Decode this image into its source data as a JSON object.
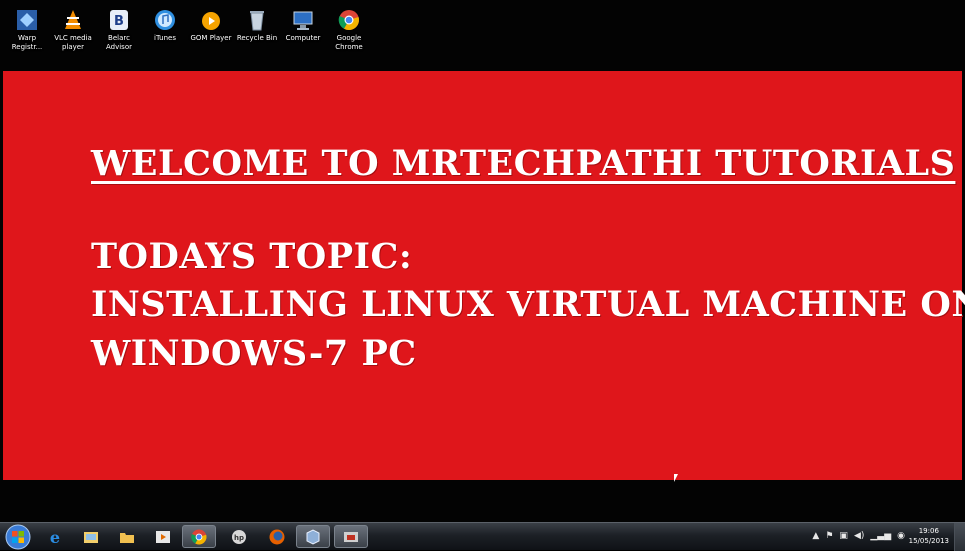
{
  "desktop": {
    "icons": [
      {
        "label": "Warp Registr...",
        "icon": "warp-registry-icon"
      },
      {
        "label": "VLC media player",
        "icon": "vlc-icon"
      },
      {
        "label": "Belarc Advisor",
        "icon": "belarc-icon"
      },
      {
        "label": "iTunes",
        "icon": "itunes-icon"
      },
      {
        "label": "GOM Player",
        "icon": "gom-player-icon"
      },
      {
        "label": "Recycle Bin",
        "icon": "recycle-bin-icon"
      },
      {
        "label": "Computer",
        "icon": "computer-icon"
      },
      {
        "label": "Google Chrome",
        "icon": "chrome-icon"
      }
    ]
  },
  "slide": {
    "background": "#df161b",
    "title": "WELCOME TO MRTECHPATHI TUTORIALS",
    "line1": "TODAYS TOPIC:",
    "line2": "INSTALLING LINUX VIRTUAL MACHINE ON",
    "line3": "WINDOWS-7 PC"
  },
  "taskbar": {
    "pinned": [
      "internet-explorer-icon",
      "windows-explorer-icon",
      "folder-icon",
      "media-player-icon",
      "chrome-icon",
      "hp-icon",
      "firefox-icon",
      "virtualbox-icon",
      "app-icon"
    ],
    "clock": {
      "time": "19:06",
      "date": "15/05/2013"
    }
  }
}
